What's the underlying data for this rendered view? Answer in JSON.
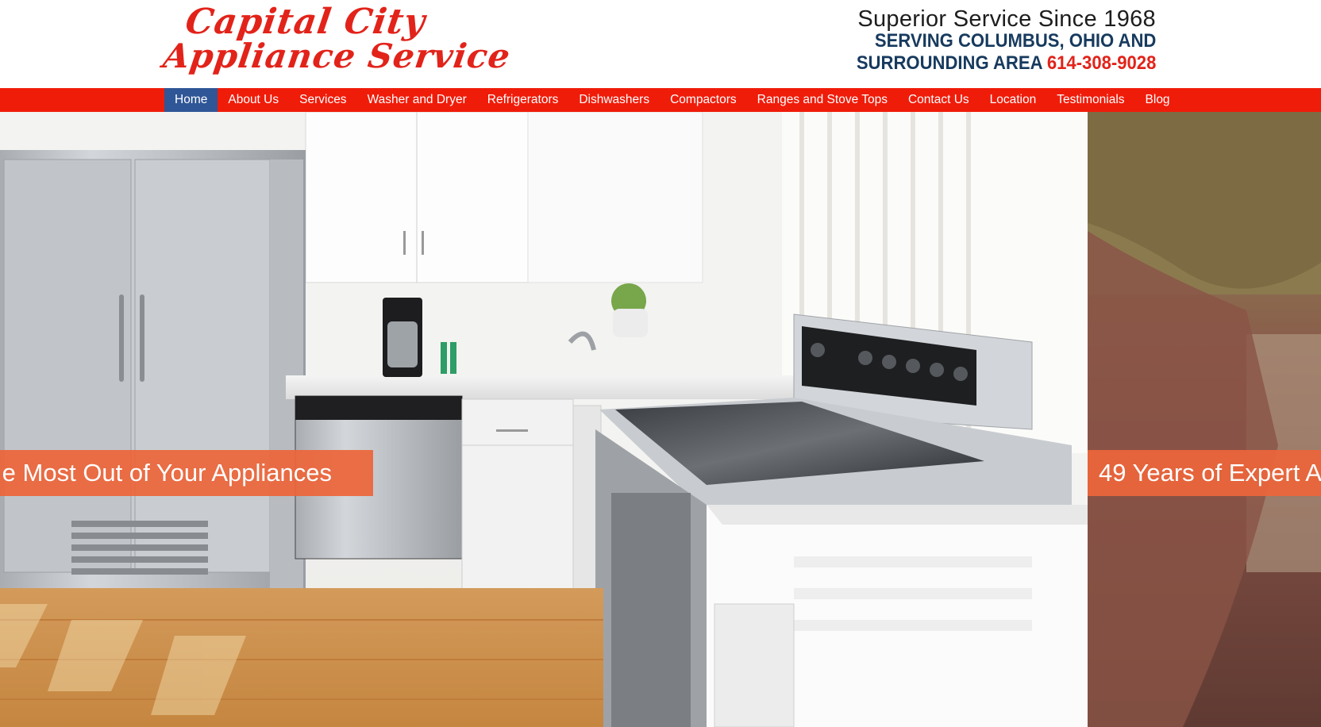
{
  "logo": {
    "line1": "Capital City",
    "line2": "Appliance Service"
  },
  "header": {
    "tagline": "Superior Service Since 1968",
    "area_line1": "SERVING COLUMBUS, OHIO AND",
    "area_line2": "SURROUNDING AREA",
    "phone": "614-308-9028"
  },
  "nav": {
    "items": [
      {
        "label": "Home"
      },
      {
        "label": "About Us"
      },
      {
        "label": "Services"
      },
      {
        "label": "Washer and Dryer"
      },
      {
        "label": "Refrigerators"
      },
      {
        "label": "Dishwashers"
      },
      {
        "label": "Compactors"
      },
      {
        "label": "Ranges and Stove Tops"
      },
      {
        "label": "Contact Us"
      },
      {
        "label": "Location"
      },
      {
        "label": "Testimonials"
      },
      {
        "label": "Blog"
      }
    ],
    "active_index": 0
  },
  "hero": {
    "slide1_caption": "e Most Out of Your Appliances",
    "slide2_caption": "49 Years of Expert A"
  },
  "colors": {
    "brand_red": "#e2231a",
    "nav_red": "#f01c0a",
    "nav_active": "#2f5696",
    "area_text": "#173a5e",
    "caption_orange": "#ec653a"
  }
}
